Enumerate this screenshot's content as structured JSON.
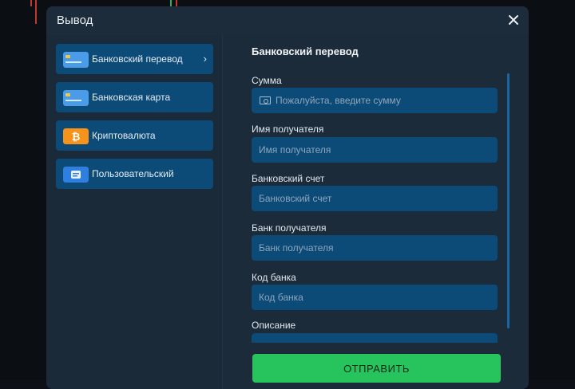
{
  "modal": {
    "title": "Вывод",
    "close_icon": "close-icon"
  },
  "sidebar": {
    "items": [
      {
        "label": "Банковский перевод",
        "icon": "bank-card-icon",
        "active": true
      },
      {
        "label": "Банковская карта",
        "icon": "bank-card-icon",
        "active": false
      },
      {
        "label": "Криптовалюта",
        "icon": "bitcoin-icon",
        "active": false
      },
      {
        "label": "Пользовательский",
        "icon": "custom-card-icon",
        "active": false
      }
    ]
  },
  "form": {
    "title": "Банковский перевод",
    "fields": [
      {
        "label": "Сумма",
        "placeholder": "Пожалуйста, введите сумму",
        "value": "",
        "icon": "money-icon"
      },
      {
        "label": "Имя получателя",
        "placeholder": "Имя получателя",
        "value": ""
      },
      {
        "label": "Банковский счет",
        "placeholder": "Банковский счет",
        "value": ""
      },
      {
        "label": "Банк получателя",
        "placeholder": "Банк получателя",
        "value": ""
      },
      {
        "label": "Код банка",
        "placeholder": "Код банка",
        "value": ""
      },
      {
        "label": "Описание",
        "placeholder": "",
        "value": ""
      }
    ],
    "submit_label": "ОТПРАВИТЬ"
  },
  "colors": {
    "modal_bg": "#1b2a38",
    "item_bg": "#0c4a78",
    "submit_bg": "#27c45e",
    "bitcoin_bg": "#f7931a",
    "card_icon_bg": "#4a9be8"
  }
}
